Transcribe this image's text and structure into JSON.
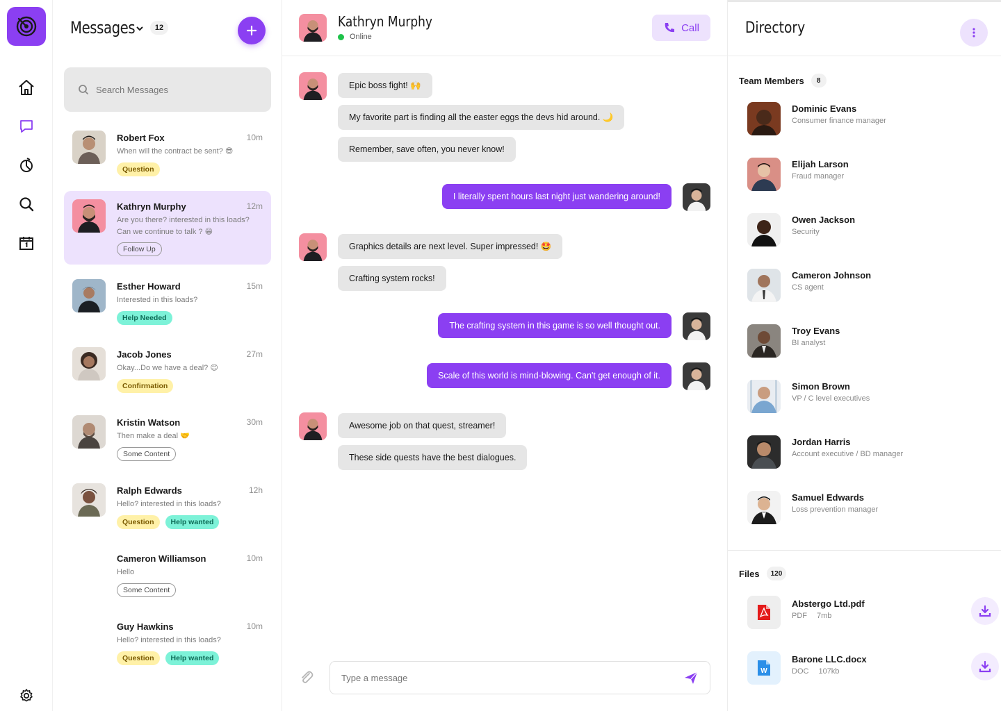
{
  "nav": {
    "items": [
      "home-icon",
      "chat-icon",
      "chart-icon",
      "search-icon",
      "calendar-icon"
    ],
    "active": "chat-icon",
    "settings": "gear-icon"
  },
  "colors": {
    "accent": "#8b3ff2",
    "accent_soft": "#ede2fd",
    "online": "#1ec24a"
  },
  "messages_panel": {
    "title": "Messages",
    "count": "12",
    "search_placeholder": "Search Messages",
    "conversations": [
      {
        "name": "Robert Fox",
        "time": "10m",
        "preview": "When will the contract be sent? 😎",
        "tags": [
          {
            "label": "Question",
            "style": "yellow"
          }
        ]
      },
      {
        "name": "Kathryn Murphy",
        "time": "12m",
        "preview": "Are you there?  interested in this loads? Can we continue to talk ? 😁",
        "tags": [
          {
            "label": "Follow Up",
            "style": "outline"
          }
        ]
      },
      {
        "name": "Esther Howard",
        "time": "15m",
        "preview": "Interested in this loads?",
        "tags": [
          {
            "label": "Help Needed",
            "style": "green"
          }
        ]
      },
      {
        "name": "Jacob Jones",
        "time": "27m",
        "preview": "Okay...Do we have a deal? 😊",
        "tags": [
          {
            "label": "Confirmation",
            "style": "yellow"
          }
        ]
      },
      {
        "name": "Kristin Watson",
        "time": "30m",
        "preview": "Then make a deal 🤝",
        "tags": [
          {
            "label": "Some Content",
            "style": "outline"
          }
        ]
      },
      {
        "name": "Ralph Edwards",
        "time": "12h",
        "preview": "Hello? interested in this loads?",
        "tags": [
          {
            "label": "Question",
            "style": "yellow"
          },
          {
            "label": "Help wanted",
            "style": "green"
          }
        ]
      },
      {
        "name": "Cameron Williamson",
        "time": "10m",
        "preview": "Hello",
        "tags": [
          {
            "label": "Some Content",
            "style": "outline"
          }
        ]
      },
      {
        "name": "Guy Hawkins",
        "time": "10m",
        "preview": "Hello? interested in this loads?",
        "tags": [
          {
            "label": "Question",
            "style": "yellow"
          },
          {
            "label": "Help wanted",
            "style": "green"
          }
        ]
      }
    ]
  },
  "chat": {
    "contact_name": "Kathryn Murphy",
    "status": "Online",
    "call_label": "Call",
    "messages": [
      {
        "dir": "in",
        "text": "Epic boss fight! 🙌"
      },
      {
        "dir": "in",
        "text": "My favorite part is finding all the easter eggs the devs hid around. 🌙"
      },
      {
        "dir": "in",
        "text": "Remember, save often, you never know!"
      },
      {
        "dir": "out",
        "text": "I literally spent hours last night just wandering around!"
      },
      {
        "dir": "in",
        "text": "Graphics details are next level. Super impressed! 🤩"
      },
      {
        "dir": "in",
        "text": "Crafting system rocks!"
      },
      {
        "dir": "out",
        "text": "The crafting system in this game is so well thought out."
      },
      {
        "dir": "out",
        "text": "Scale of this world is mind-blowing. Can't get enough of it."
      },
      {
        "dir": "in",
        "text": "Awesome job on that quest, streamer!"
      },
      {
        "dir": "in",
        "text": "These side quests have the best dialogues."
      }
    ],
    "compose_placeholder": "Type a message"
  },
  "directory": {
    "title": "Directory",
    "team_label": "Team Members",
    "team_count": "8",
    "members": [
      {
        "name": "Dominic Evans",
        "role": "Consumer finance manager"
      },
      {
        "name": "Elijah Larson",
        "role": "Fraud manager"
      },
      {
        "name": "Owen Jackson",
        "role": "Security"
      },
      {
        "name": "Cameron Johnson",
        "role": "CS agent"
      },
      {
        "name": "Troy Evans",
        "role": "BI analyst"
      },
      {
        "name": "Simon Brown",
        "role": "VP / C level executives"
      },
      {
        "name": "Jordan Harris",
        "role": "Account executive / BD manager"
      },
      {
        "name": "Samuel Edwards",
        "role": "Loss prevention manager"
      }
    ],
    "files_label": "Files",
    "files_count": "120",
    "files": [
      {
        "name": "Abstergo Ltd.pdf",
        "type": "PDF",
        "size": "7mb",
        "icon": "pdf-icon"
      },
      {
        "name": "Barone LLC.docx",
        "type": "DOC",
        "size": "107kb",
        "icon": "doc-icon"
      }
    ]
  }
}
